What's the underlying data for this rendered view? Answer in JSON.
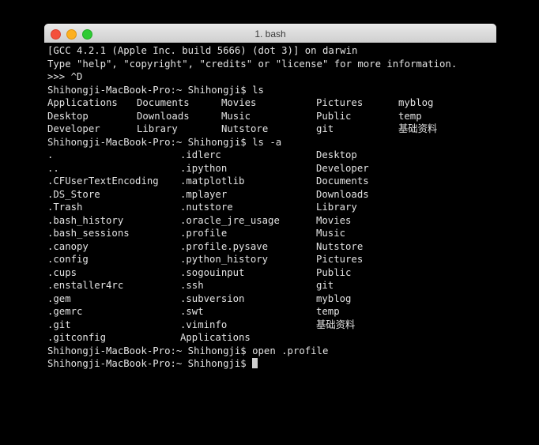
{
  "window": {
    "title": "1. bash",
    "controls": [
      {
        "name": "close",
        "color": "#f4503c"
      },
      {
        "name": "minimize",
        "color": "#fdb01f"
      },
      {
        "name": "zoom",
        "color": "#2ecb33"
      }
    ]
  },
  "terminal": {
    "prompt": "Shihongji-MacBook-Pro:~ Shihongji$ ",
    "foreground": "#e3e3e3",
    "background": "#000000",
    "header_lines": [
      "[GCC 4.2.1 (Apple Inc. build 5666) (dot 3)] on darwin",
      "Type \"help\", \"copyright\", \"credits\" or \"license\" for more information.",
      ">>> ^D"
    ],
    "command_ls": "Shihongji-MacBook-Pro:~ Shihongji$ ls",
    "ls_rows": [
      [
        "Applications",
        "Documents",
        "Movies",
        "Pictures",
        "myblog"
      ],
      [
        "Desktop",
        "Downloads",
        "Music",
        "Public",
        "temp"
      ],
      [
        "Developer",
        "Library",
        "Nutstore",
        "git",
        "基础资料"
      ]
    ],
    "command_ls_a": "Shihongji-MacBook-Pro:~ Shihongji$ ls -a",
    "ls_a_rows": [
      [
        ".",
        ".idlerc",
        "Desktop"
      ],
      [
        "..",
        ".ipython",
        "Developer"
      ],
      [
        ".CFUserTextEncoding",
        ".matplotlib",
        "Documents"
      ],
      [
        ".DS_Store",
        ".mplayer",
        "Downloads"
      ],
      [
        ".Trash",
        ".nutstore",
        "Library"
      ],
      [
        ".bash_history",
        ".oracle_jre_usage",
        "Movies"
      ],
      [
        ".bash_sessions",
        ".profile",
        "Music"
      ],
      [
        ".canopy",
        ".profile.pysave",
        "Nutstore"
      ],
      [
        ".config",
        ".python_history",
        "Pictures"
      ],
      [
        ".cups",
        ".sogouinput",
        "Public"
      ],
      [
        ".enstaller4rc",
        ".ssh",
        "git"
      ],
      [
        ".gem",
        ".subversion",
        "myblog"
      ],
      [
        ".gemrc",
        ".swt",
        "temp"
      ],
      [
        ".git",
        ".viminfo",
        "基础资料"
      ],
      [
        ".gitconfig",
        "Applications",
        ""
      ]
    ],
    "command_open": "Shihongji-MacBook-Pro:~ Shihongji$ open .profile",
    "final_prompt": "Shihongji-MacBook-Pro:~ Shihongji$ "
  }
}
